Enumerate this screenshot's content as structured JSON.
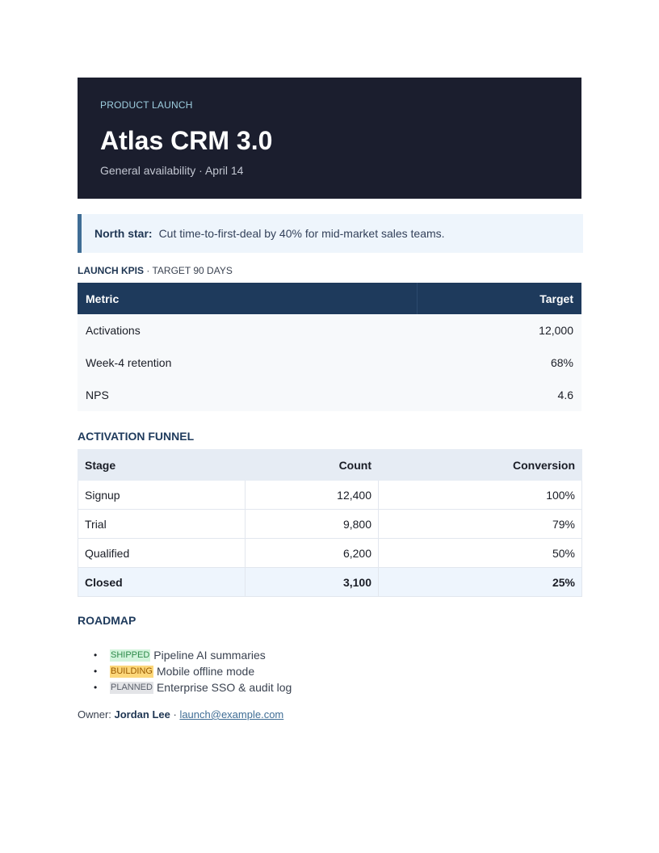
{
  "hero": {
    "kicker": "PRODUCT LAUNCH",
    "title": "Atlas CRM 3.0",
    "subtitle": "General availability · April 14"
  },
  "callout": {
    "label": "North star:",
    "text": "Cut time-to-first-deal by 40% for mid-market sales teams."
  },
  "kpis": {
    "heading": "LAUNCH KPIS",
    "subheading": " · TARGET 90 DAYS",
    "columns": [
      "Metric",
      "Target"
    ],
    "rows": [
      {
        "metric": "Activations",
        "target": "12,000"
      },
      {
        "metric": "Week-4 retention",
        "target": "68%"
      },
      {
        "metric": "NPS",
        "target": "4.6"
      }
    ]
  },
  "funnel": {
    "title": "ACTIVATION FUNNEL",
    "columns": [
      "Stage",
      "Count",
      "Conversion"
    ],
    "rows": [
      {
        "stage": "Signup",
        "count": "12,400",
        "conversion": "100%"
      },
      {
        "stage": "Trial",
        "count": "9,800",
        "conversion": "79%"
      },
      {
        "stage": "Qualified",
        "count": "6,200",
        "conversion": "50%"
      },
      {
        "stage": "Closed",
        "count": "3,100",
        "conversion": "25%"
      }
    ]
  },
  "roadmap": {
    "title": "ROADMAP",
    "items": [
      {
        "status": "SHIPPED",
        "text": "Pipeline AI summaries"
      },
      {
        "status": "BUILDING",
        "text": "Mobile offline mode"
      },
      {
        "status": "PLANNED",
        "text": "Enterprise SSO & audit log"
      }
    ]
  },
  "owner": {
    "label": "Owner: ",
    "name": "Jordan Lee",
    "separator": " · ",
    "email": "launch@example.com"
  },
  "colors": {
    "hero_bg": "#1b1e2e",
    "accent": "#1e3a5c",
    "shipped": "#d2f4dc",
    "building": "#fcd77a",
    "planned": "#e3e4e7"
  }
}
